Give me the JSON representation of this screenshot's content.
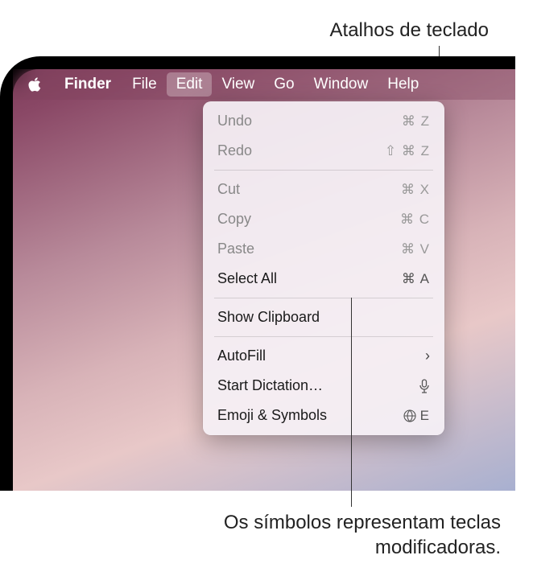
{
  "callouts": {
    "top": "Atalhos de teclado",
    "bottom": "Os símbolos representam teclas modificadoras."
  },
  "menubar": {
    "app": "Finder",
    "items": [
      "File",
      "Edit",
      "View",
      "Go",
      "Window",
      "Help"
    ],
    "active_index": 1
  },
  "dropdown": {
    "groups": [
      [
        {
          "label": "Undo",
          "shortcut": "⌘ Z",
          "disabled": true
        },
        {
          "label": "Redo",
          "shortcut": "⇧ ⌘ Z",
          "disabled": true
        }
      ],
      [
        {
          "label": "Cut",
          "shortcut": "⌘ X",
          "disabled": true
        },
        {
          "label": "Copy",
          "shortcut": "⌘ C",
          "disabled": true
        },
        {
          "label": "Paste",
          "shortcut": "⌘ V",
          "disabled": true
        },
        {
          "label": "Select All",
          "shortcut": "⌘ A",
          "disabled": false
        }
      ],
      [
        {
          "label": "Show Clipboard",
          "shortcut": "",
          "disabled": false
        }
      ],
      [
        {
          "label": "AutoFill",
          "shortcut": "",
          "disabled": false,
          "submenu": true
        },
        {
          "label": "Start Dictation…",
          "shortcut": "mic",
          "disabled": false,
          "icon": "mic"
        },
        {
          "label": "Emoji & Symbols",
          "shortcut": "🌐 E",
          "disabled": false,
          "icon": "globe"
        }
      ]
    ]
  }
}
